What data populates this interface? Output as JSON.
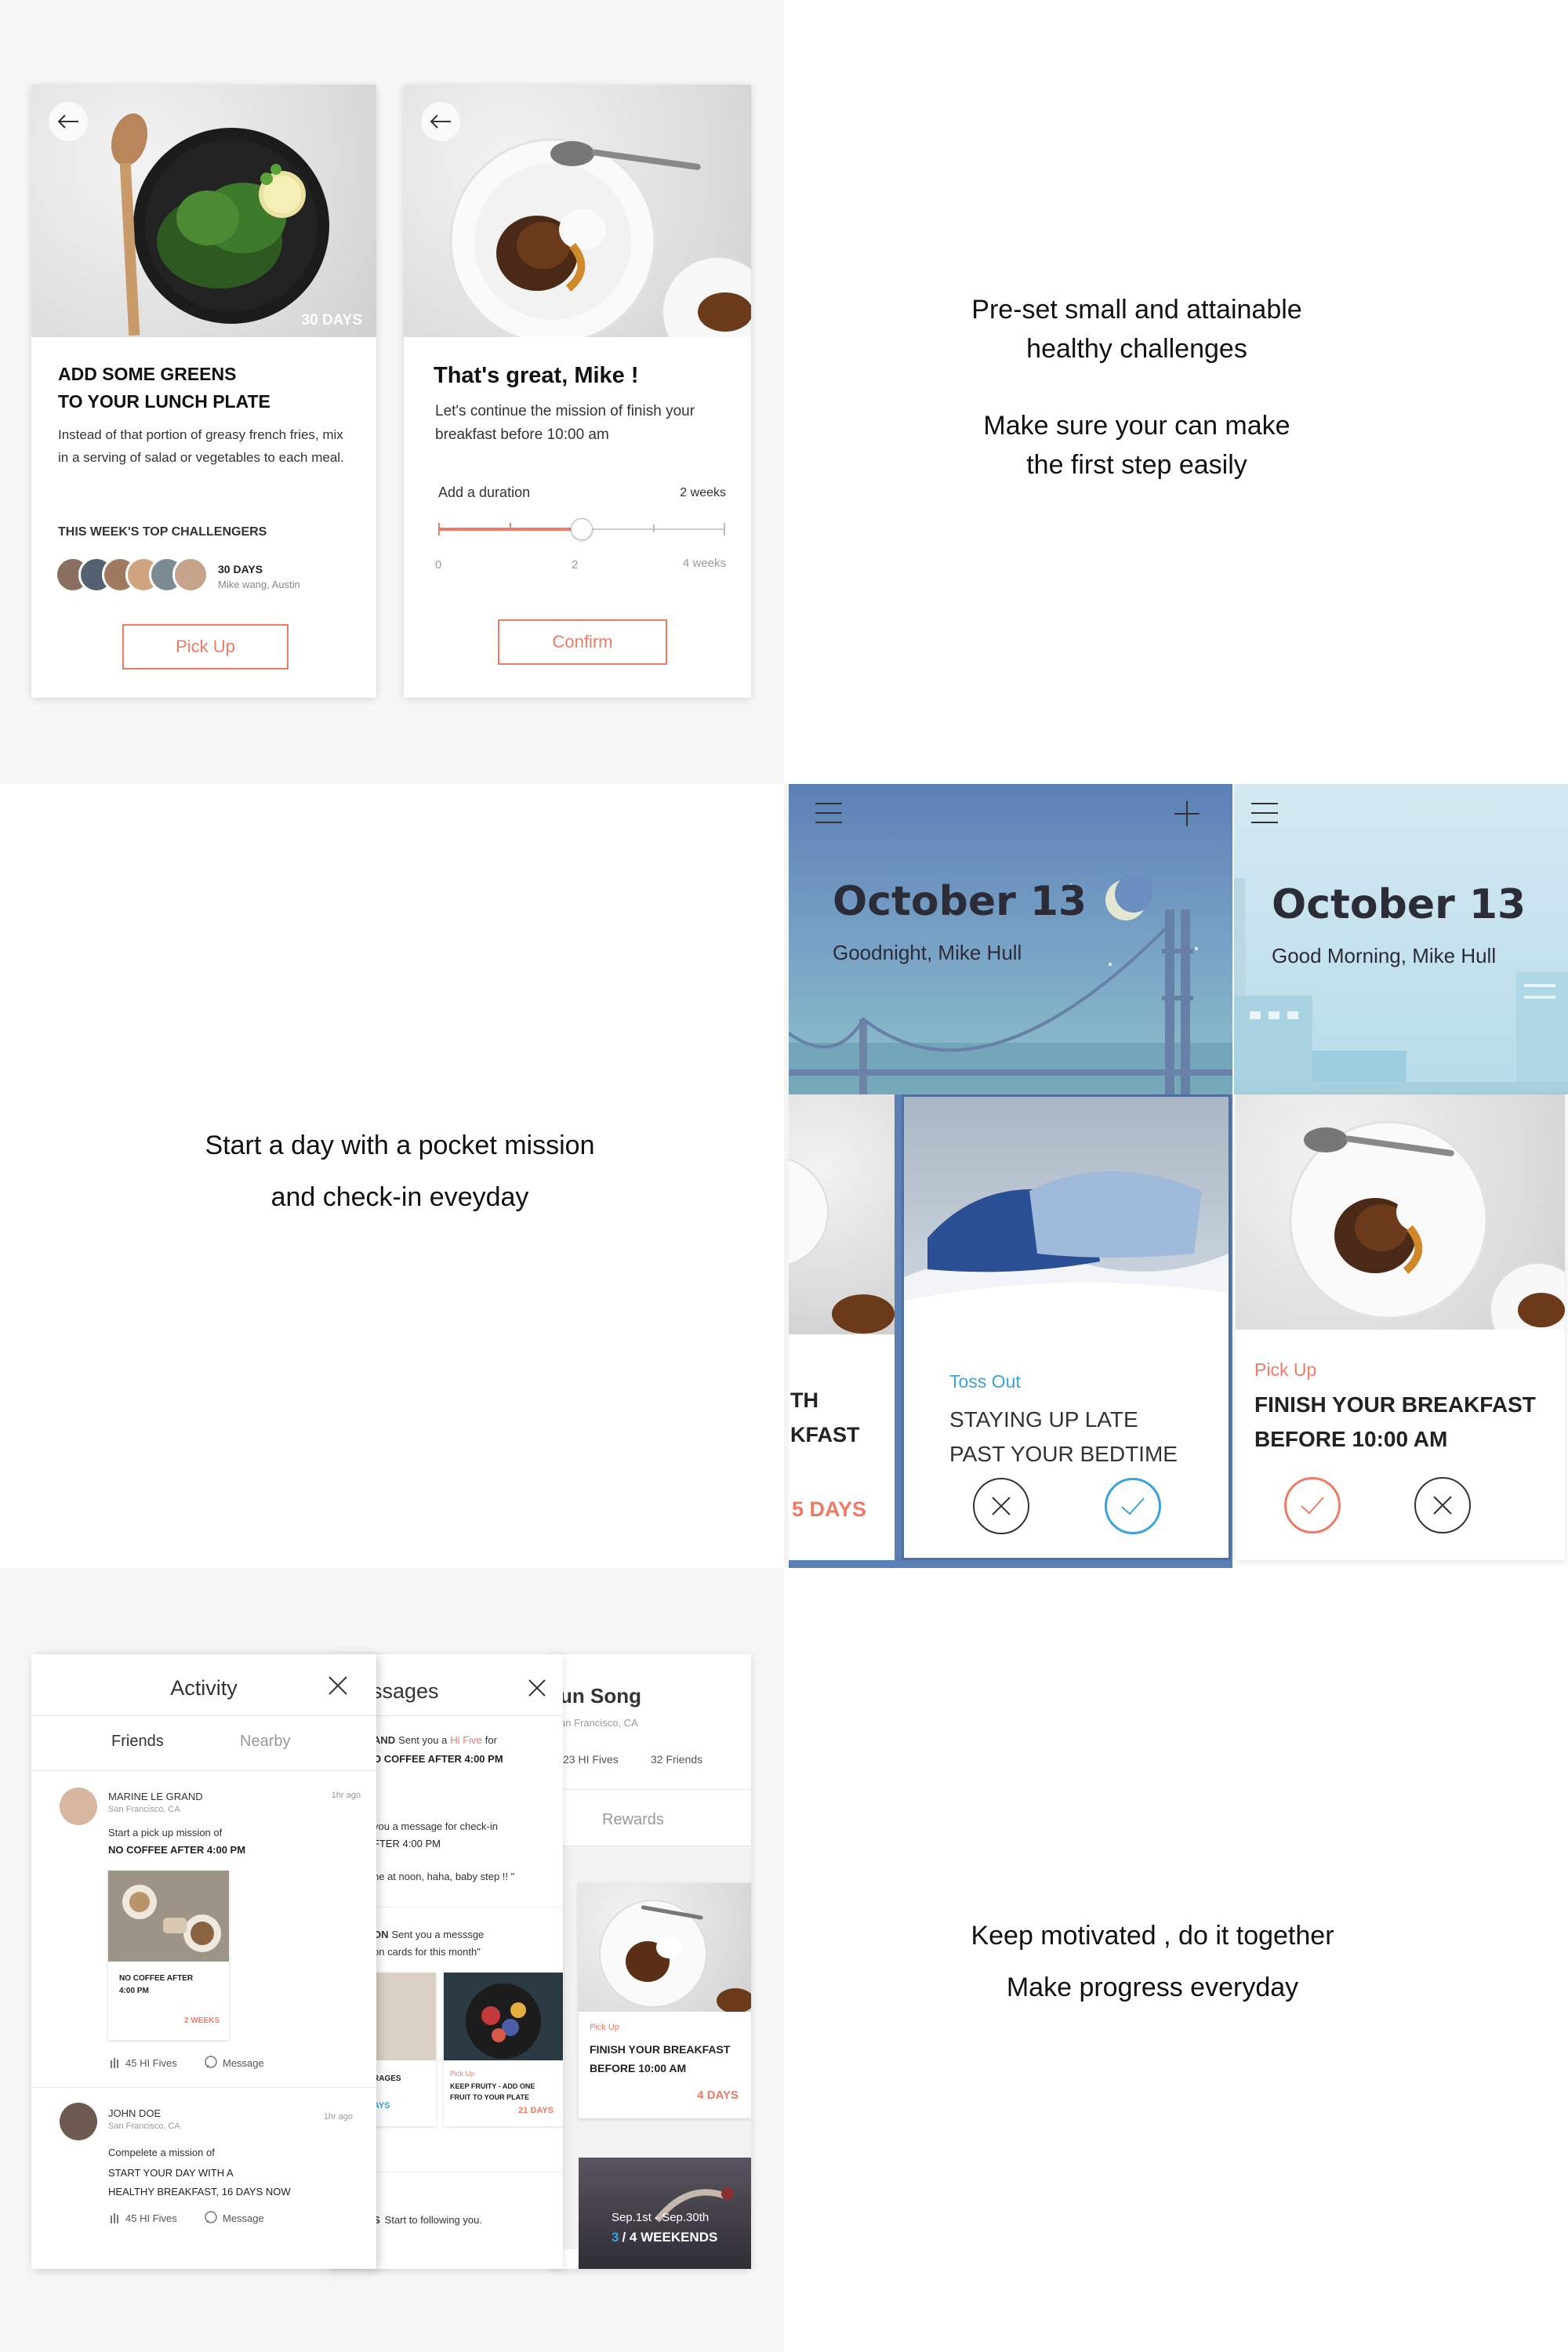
{
  "section1": {
    "card1": {
      "days_badge": "30 DAYS",
      "title_line1": "ADD SOME GREENS",
      "title_line2": "TO YOUR LUNCH PLATE",
      "desc": "Instead of that portion of greasy french fries, mix in a serving of salad or vegetables to each meal.",
      "challengers_heading": "THIS WEEK'S TOP CHALLENGERS",
      "challenger_days": "30 DAYS",
      "challenger_names": "Mike wang, Austin",
      "button": "Pick Up"
    },
    "card2": {
      "greeting": "That's great, Mike !",
      "message": "Let's continue the mission of finish your breakfast before 10:00 am",
      "duration_label": "Add a duration",
      "duration_value": "2 weeks",
      "tick_min": "0",
      "tick_mid": "2",
      "tick_max": "4 weeks",
      "slider_fraction": 0.5,
      "button": "Confirm"
    },
    "caption_line1": "Pre-set small and attainable",
    "caption_line2": "healthy challenges",
    "caption_line3": "Make sure your can make",
    "caption_line4": "the first step easily"
  },
  "section2": {
    "caption_line1": "Start a day with a  pocket mission",
    "caption_line2": "and check-in eveyday",
    "night": {
      "date": "October 13",
      "greeting": "Goodnight, Mike Hull",
      "peek_line1": "TH",
      "peek_line2": "KFAST",
      "peek_days": "5 DAYS",
      "status": "Toss Out",
      "title_line1": "STAYING UP LATE",
      "title_line2": "PAST YOUR BEDTIME"
    },
    "morning": {
      "date": "October 13",
      "greeting": "Good Morning, Mike Hull",
      "status": "Pick Up",
      "title_line1": "FINISH YOUR BREAKFAST",
      "title_line2": "BEFORE 10:00 AM"
    },
    "colors": {
      "accent": "#ee7b66",
      "blue": "#3aa3d9",
      "night_sky": "#5b80b6"
    }
  },
  "section3": {
    "activity": {
      "title": "Activity",
      "tab_friends": "Friends",
      "tab_nearby": "Nearby",
      "items": [
        {
          "name": "MARINE LE GRAND",
          "location": "San Francisco, CA",
          "time": "1hr ago",
          "action": "Start a pick up mission of",
          "mission": "NO COFFEE AFTER 4:00 PM",
          "card_title": "NO COFFEE AFTER 4:00 PM",
          "card_days": "2 WEEKS",
          "hi_fives": "45 HI Fives",
          "message": "Message"
        },
        {
          "name": "JOHN DOE",
          "location": "San Francisco, CA",
          "time": "1hr ago",
          "action": "Compelete a mission of",
          "mission_line1": "START YOUR DAY WITH A",
          "mission_line2": "HEALTHY BREAKFAST, 16 DAYS NOW",
          "hi_fives": "45 HI Fives",
          "message": "Message"
        }
      ]
    },
    "messages": {
      "title": "ssages",
      "m1_from": "AND",
      "m1_text": "Sent you a",
      "m1_hifive": "Hi Five",
      "m1_for": "for",
      "m1_mission": "O COFFEE AFTER 4:00 PM",
      "m2_line1": "you a message for check-in",
      "m2_line2": "FTER 4:00 PM",
      "m2_quote": "ne at noon, haha, baby step !! \"",
      "m3_from": "ON",
      "m3_text": "Sent you a messsge",
      "m3_line2": "on cards for this month\"",
      "tile_left_label": "RAGES",
      "tile_left_days": "AYS",
      "tile_right_status": "Pick Up",
      "tile_right_line1": "KEEP FRUITY - ADD ONE",
      "tile_right_line2": "FRUIT TO YOUR PLATE",
      "tile_right_days": "21 DAYS",
      "m4_from": "S",
      "m4_text": "Start to following you."
    },
    "profile": {
      "name": "un Song",
      "location": "an Francisco, CA",
      "hi_fives": "23 HI Fives",
      "friends": "32 Friends",
      "tab_rewards": "Rewards",
      "tile_status": "Pick Up",
      "tile_line1": "FINISH YOUR BREAKFAST",
      "tile_line2": "BEFORE 10:00 AM",
      "tile_days": "4 DAYS",
      "event_dates": "Sep.1st - Sep.30th",
      "event_progress": "3",
      "event_total": "/ 4 WEEKENDS"
    },
    "caption_line1": "Keep motivated , do it together",
    "caption_line2": "Make progress everyday"
  }
}
